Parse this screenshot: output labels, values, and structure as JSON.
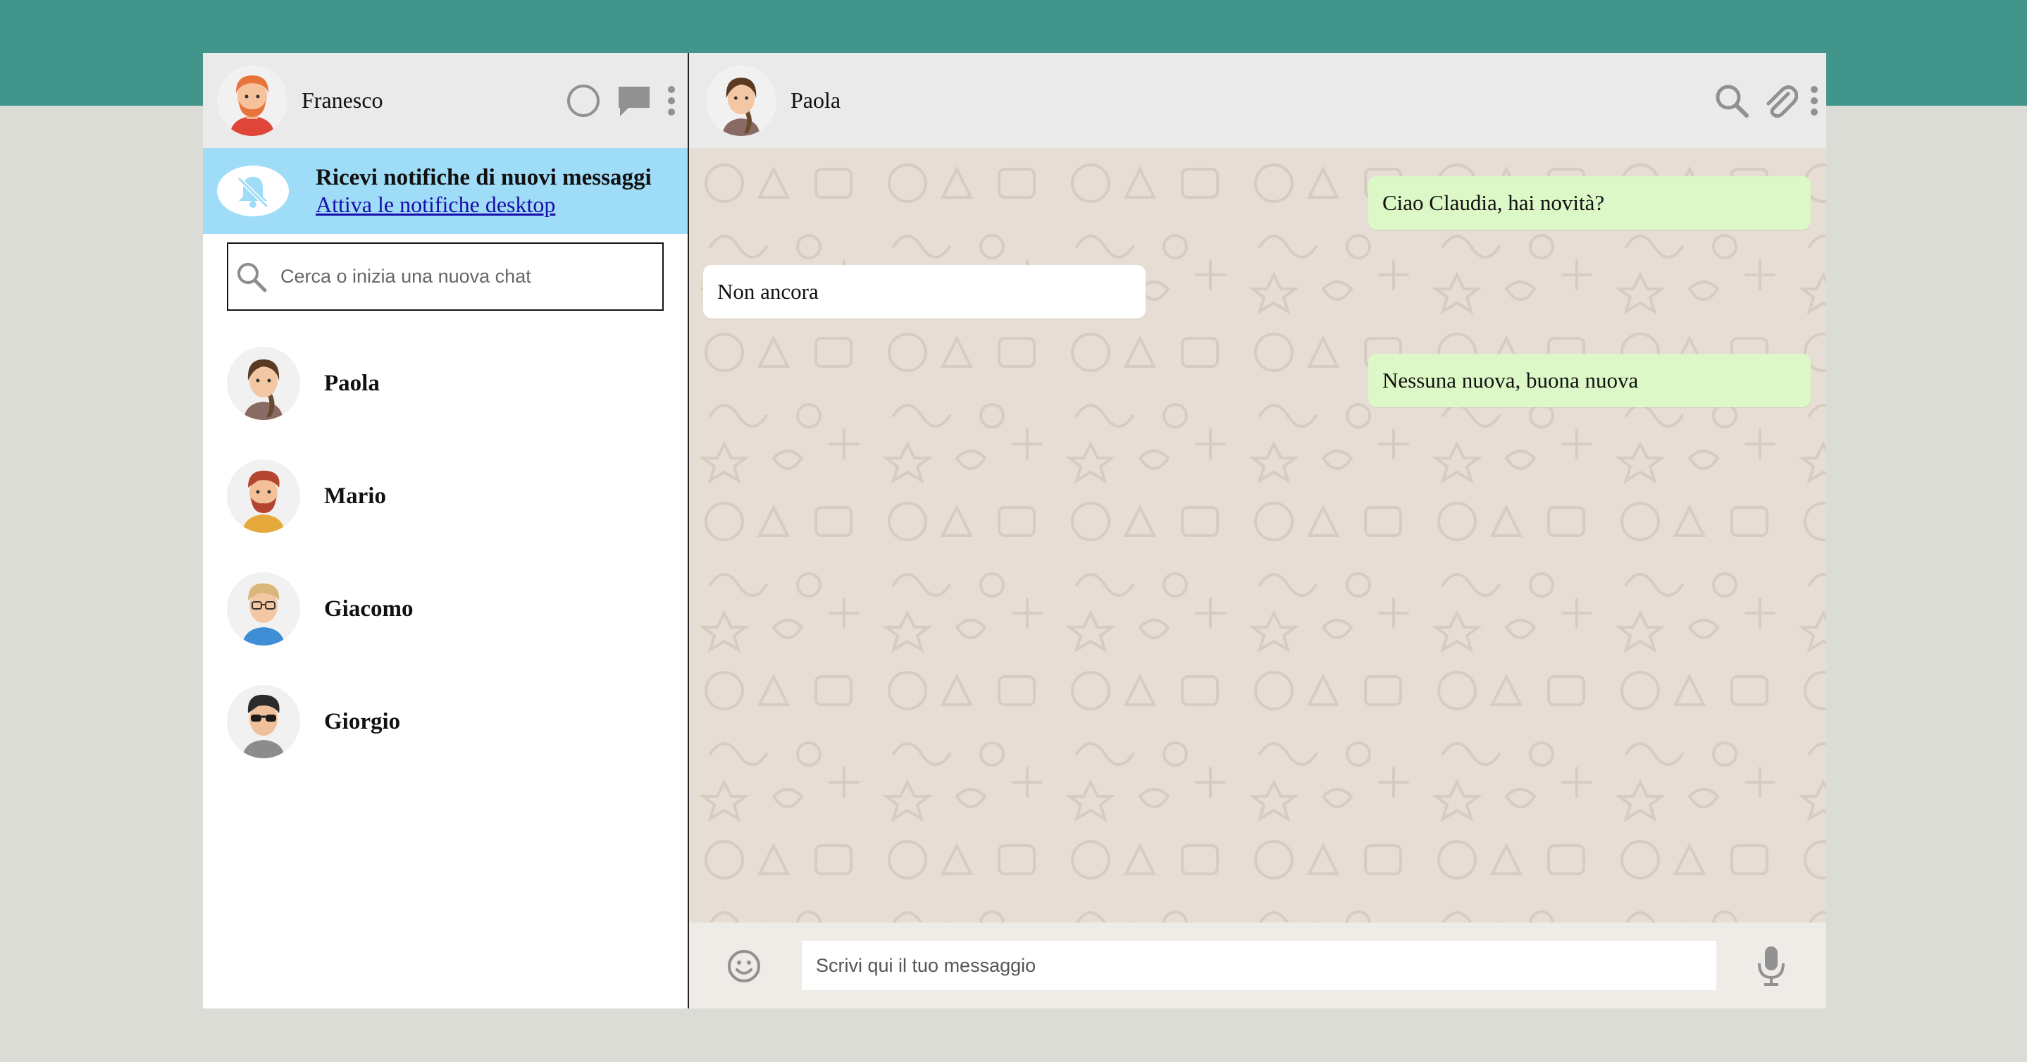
{
  "user": {
    "name": "Franesco"
  },
  "notification": {
    "title": "Ricevi notifiche di nuovi messaggi",
    "link": "Attiva le notifiche desktop"
  },
  "search": {
    "placeholder": "Cerca o inizia una nuova chat"
  },
  "contacts": [
    {
      "name": "Paola"
    },
    {
      "name": "Mario"
    },
    {
      "name": "Giacomo"
    },
    {
      "name": "Giorgio"
    }
  ],
  "active_chat": {
    "name": "Paola"
  },
  "messages": [
    {
      "direction": "sent",
      "text": "Ciao Claudia, hai novità?"
    },
    {
      "direction": "received",
      "text": "Non ancora"
    },
    {
      "direction": "sent",
      "text": "Nessuna nuova, buona nuova"
    }
  ],
  "composer": {
    "placeholder": "Scrivi qui il tuo messaggio"
  },
  "colors": {
    "top_band": "#41958a",
    "background": "#dcdcd6",
    "header": "#eaeaea",
    "notification": "#9fdcf7",
    "sent_bubble": "#dcf8c6",
    "received_bubble": "#ffffff",
    "chat_background": "#e6ddd4"
  },
  "icons": [
    "status-icon",
    "new-chat-icon",
    "menu-dots-icon",
    "bell-off-icon",
    "search-icon",
    "attach-icon",
    "emoji-icon",
    "mic-icon"
  ]
}
